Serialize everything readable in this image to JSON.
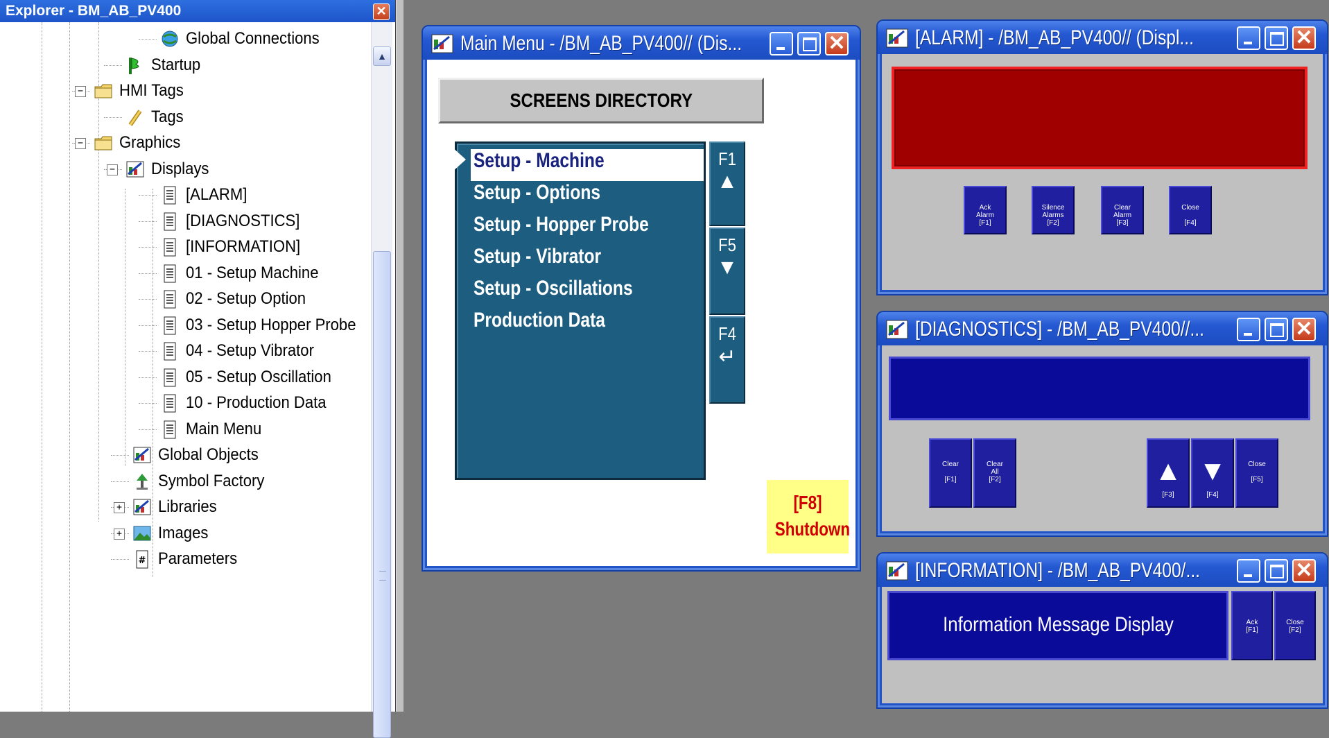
{
  "explorer": {
    "title": "Explorer - BM_AB_PV400",
    "close_glyph": "✕",
    "items": [
      {
        "label": "Global Connections",
        "icon": "globe-icon"
      },
      {
        "label": "Startup",
        "icon": "startup-icon"
      },
      {
        "label": "HMI Tags",
        "icon": "folder-icon",
        "expander": "⊟"
      },
      {
        "label": "Tags",
        "icon": "tags-icon"
      },
      {
        "label": "Graphics",
        "icon": "folder-icon",
        "expander": "⊟"
      },
      {
        "label": "Displays",
        "icon": "displays-icon",
        "expander": "⊟"
      },
      {
        "label": "[ALARM]",
        "icon": "document-icon"
      },
      {
        "label": "[DIAGNOSTICS]",
        "icon": "document-icon"
      },
      {
        "label": "[INFORMATION]",
        "icon": "document-icon"
      },
      {
        "label": "01 - Setup Machine",
        "icon": "document-icon"
      },
      {
        "label": "02 - Setup Option",
        "icon": "document-icon"
      },
      {
        "label": "03 - Setup Hopper Probe",
        "icon": "document-icon"
      },
      {
        "label": "04 - Setup Vibrator",
        "icon": "document-icon"
      },
      {
        "label": "05 - Setup Oscillation",
        "icon": "document-icon"
      },
      {
        "label": "10 - Production Data",
        "icon": "document-icon"
      },
      {
        "label": "Main Menu",
        "icon": "document-icon"
      },
      {
        "label": "Global Objects",
        "icon": "displays-icon"
      },
      {
        "label": "Symbol Factory",
        "icon": "symbol-factory-icon"
      },
      {
        "label": "Libraries",
        "icon": "displays-icon",
        "expander": "+"
      },
      {
        "label": "Images",
        "icon": "images-icon",
        "expander": "+"
      },
      {
        "label": "Parameters",
        "icon": "parameters-icon"
      }
    ]
  },
  "main_menu": {
    "title": "Main Menu - /BM_AB_PV400// (Dis...",
    "header": "SCREENS DIRECTORY",
    "items": [
      "Setup - Machine",
      "Setup - Options",
      "Setup - Hopper Probe",
      "Setup - Vibrator",
      "Setup - Oscillations",
      "Production Data"
    ],
    "selected_index": 0,
    "fkeys": {
      "f1": "F1",
      "up": "▲",
      "f5": "F5",
      "down": "▼",
      "f4": "F4",
      "enter": "↵"
    },
    "shutdown_key": "[F8]",
    "shutdown_label": "Shutdown"
  },
  "alarm": {
    "title": "[ALARM] - /BM_AB_PV400// (Displ...",
    "buttons": [
      "Ack\nAlarm\n[F1]",
      "Silence\nAlarms\n[F2]",
      "Clear\nAlarm\n[F3]",
      "Close\n\n[F4]"
    ]
  },
  "diagnostics": {
    "title": "[DIAGNOSTICS] - /BM_AB_PV400//...",
    "clear": "Clear\n\n[F1]",
    "clear_all": "Clear\nAll\n[F2]",
    "up_key": "[F3]",
    "down_key": "[F4]",
    "close": "Close\n\n[F5]"
  },
  "information": {
    "title": "[INFORMATION] - /BM_AB_PV400/...",
    "display_text": "Information Message Display",
    "ack": "Ack\n[F1]",
    "close": "Close\n[F2]"
  },
  "colors": {
    "titlebar": "#2153c9",
    "menu_bg": "#1d5e80",
    "alarm_red": "#a00000",
    "hmi_blue": "#0b0b9a",
    "shutdown_bg": "#ffff88"
  }
}
